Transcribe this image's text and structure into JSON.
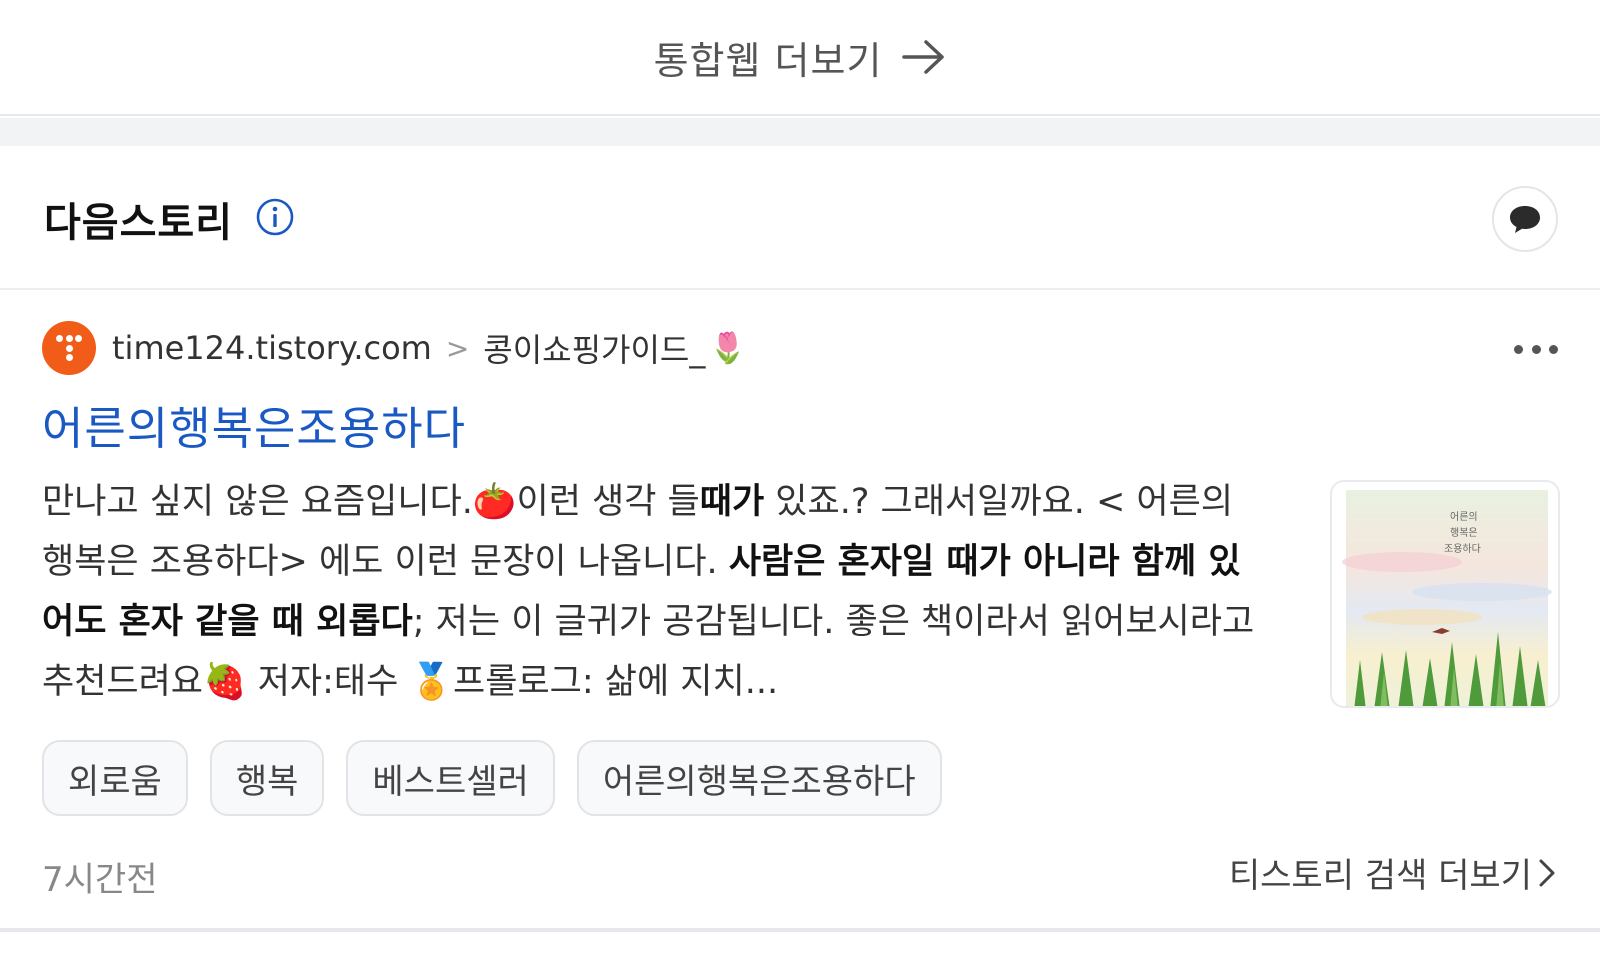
{
  "top_more": {
    "label": "통합웹 더보기",
    "arrow_icon": "arrow-right-icon"
  },
  "section": {
    "title": "다음스토리",
    "info_icon": "info-icon",
    "chat_icon": "speech-bubble-icon"
  },
  "result": {
    "favicon": "tistory-favicon",
    "domain": "time124.tistory.com",
    "separator": ">",
    "blog_name": "콩이쇼핑가이드_",
    "blog_emoji": "🌷",
    "more_icon": "more-dots-icon",
    "title": "어른의행복은조용하다",
    "snippet": {
      "p1": "만나고 싶지 않은 요즘입니다.",
      "e1": "🍅",
      "p2": "이런 생각 들",
      "b1": "때가",
      "p3": " 있죠.? 그래서일까요. < 어른의 행복은 조용하다> 에도 이런 문장이 나옵니다. ",
      "b2": "사람은 혼자일 때가 아니라 함께 있어도 혼자 같을 때 외롭다",
      "p4": "; 저는 이 글귀가 공감됩니다. 좋은 책이라서 읽어보시라고 추천드려요",
      "e2": "🍓",
      "p5": " 저자:태수 ",
      "e3": "🏅",
      "p6": "프롤로그: 삶에 지치..."
    },
    "thumbnail": {
      "alt": "book-cover-thumbnail",
      "cover_text": [
        "어른의",
        "행복은",
        "조용하다"
      ]
    },
    "tags": [
      "외로움",
      "행복",
      "베스트셀러",
      "어른의행복은조용하다"
    ],
    "time": "7시간전",
    "more_label": "티스토리 검색 더보기",
    "more_chevron": "chevron-right-icon"
  },
  "colors": {
    "title_link": "#1a59c4",
    "favicon_bg": "#f25c19",
    "info_icon": "#1a59c4",
    "divider": "#e6e8ec"
  }
}
